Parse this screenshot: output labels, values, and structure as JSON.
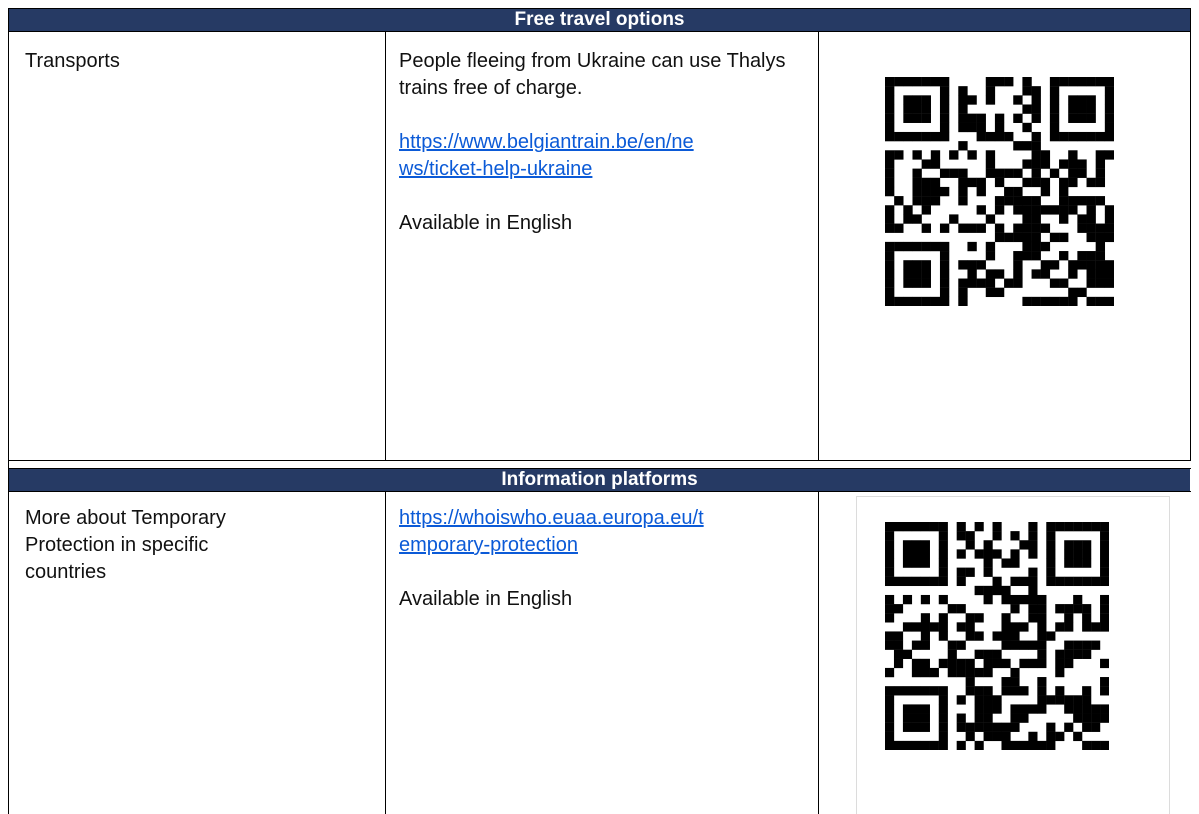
{
  "sections": [
    {
      "header": "Free travel options",
      "label": "Transports",
      "description": "People fleeing from Ukraine can use Thalys trains free of charge.",
      "link_line1": "https://www.belgiantrain.be/en/ne",
      "link_line2": "ws/ticket-help-ukraine",
      "availability": "Available in English",
      "qr_icon": "qr-code-icon"
    },
    {
      "header": "Information platforms",
      "label_line1": "More about Temporary",
      "label_line2": "Protection in specific",
      "label_line3": "countries",
      "link_line1": "https://whoiswho.euaa.europa.eu/t",
      "link_line2": "emporary-protection",
      "availability": "Available in English",
      "qr_icon": "qr-code-icon"
    }
  ],
  "colors": {
    "header_bg": "#263a64",
    "header_text": "#ffffff",
    "link": "#0b5ad7"
  }
}
